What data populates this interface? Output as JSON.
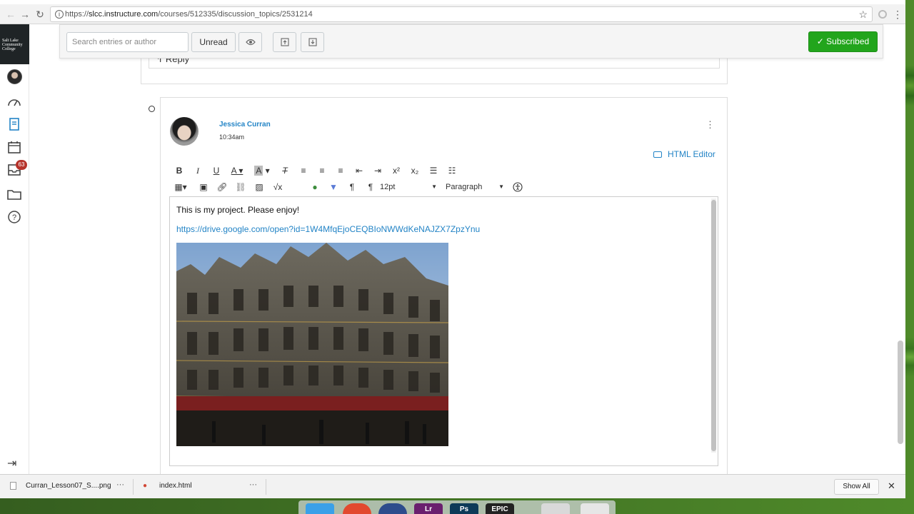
{
  "browser": {
    "url_domain": "slcc.instructure.com",
    "url_path": "/courses/512335/discussion_topics/2531214",
    "url_prefix": "https://"
  },
  "gnav": {
    "logo_text": "Salt Lake Community College",
    "inbox_badge": "63"
  },
  "toolbar": {
    "search_placeholder": "Search entries or author",
    "unread_label": "Unread",
    "subscribed_label": "Subscribed",
    "subscribed_color": "#22a51c"
  },
  "previous_entry": {
    "reply_label": "Reply"
  },
  "entry": {
    "author": "Jessica Curran",
    "time": "10:34am",
    "html_editor_label": "HTML Editor",
    "font_size": "12pt",
    "block_format": "Paragraph",
    "body_text": "This is my project. Please enjoy!",
    "link_text": "https://drive.google.com/open?id=1W4MfqEjoCEQBIoNWWdKeNAJZX7ZpzYnu"
  },
  "downloads": {
    "file1": "Curran_Lesson07_S....png",
    "file2": "index.html",
    "show_all_label": "Show All"
  },
  "dock": {
    "apps": [
      {
        "label": "Lr",
        "color": "#6a1f6e"
      },
      {
        "label": "Ps",
        "color": "#0d3a58"
      },
      {
        "label": "EPIC",
        "color": "#222222"
      }
    ]
  },
  "colors": {
    "link": "#2384c6",
    "badge": "#b6332b"
  }
}
